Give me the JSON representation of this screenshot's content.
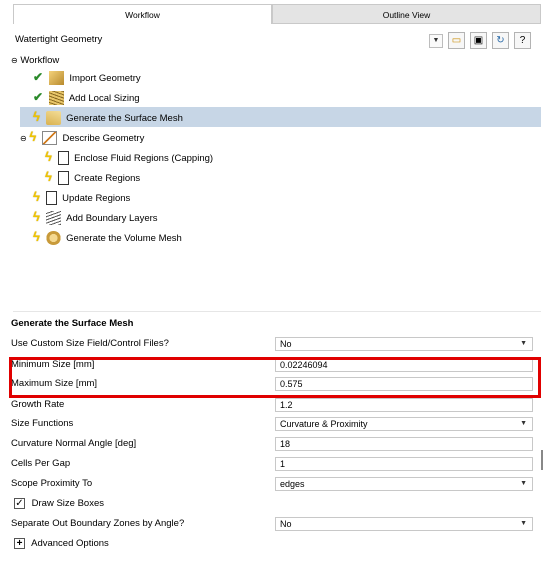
{
  "tabs": {
    "workflow": "Workflow",
    "outline": "Outline View"
  },
  "workflow_type": {
    "value": "Watertight Geometry"
  },
  "toolbar_icons": [
    "folder-icon",
    "save-icon",
    "refresh-icon",
    "help-icon"
  ],
  "tree": {
    "root": "Workflow",
    "items": [
      {
        "label": "Import Geometry",
        "status": "done"
      },
      {
        "label": "Add Local Sizing",
        "status": "done"
      },
      {
        "label": "Generate the Surface Mesh",
        "status": "pending",
        "selected": true
      },
      {
        "label": "Describe Geometry",
        "status": "pending"
      },
      {
        "label": "Enclose Fluid Regions (Capping)",
        "status": "pending"
      },
      {
        "label": "Create Regions",
        "status": "pending"
      },
      {
        "label": "Update Regions",
        "status": "pending"
      },
      {
        "label": "Add Boundary Layers",
        "status": "pending"
      },
      {
        "label": "Generate the Volume Mesh",
        "status": "pending"
      }
    ]
  },
  "panel": {
    "title": "Generate the Surface Mesh",
    "props": [
      {
        "label": "Use Custom Size Field/Control Files?",
        "value": "No"
      },
      {
        "label": "Minimum Size [mm]",
        "value": "0.02246094"
      },
      {
        "label": "Maximum Size [mm]",
        "value": "0.575"
      },
      {
        "label": "Growth Rate",
        "value": "1.2"
      },
      {
        "label": "Size Functions",
        "value": "Curvature & Proximity"
      },
      {
        "label": "Curvature Normal Angle [deg]",
        "value": "18"
      },
      {
        "label": "Cells Per Gap",
        "value": "1"
      },
      {
        "label": "Scope Proximity To",
        "value": "edges"
      },
      {
        "label": "Draw Size Boxes",
        "value": "✓"
      },
      {
        "label": "Separate Out Boundary Zones by Angle?",
        "value": "No"
      },
      {
        "label": "Advanced Options",
        "value": "+"
      }
    ]
  },
  "colors": {
    "selection": "#c7d6e6",
    "highlight_box": "#e00000",
    "done_check": "#2b8a2b",
    "pending_bolt": "#f0c400"
  }
}
